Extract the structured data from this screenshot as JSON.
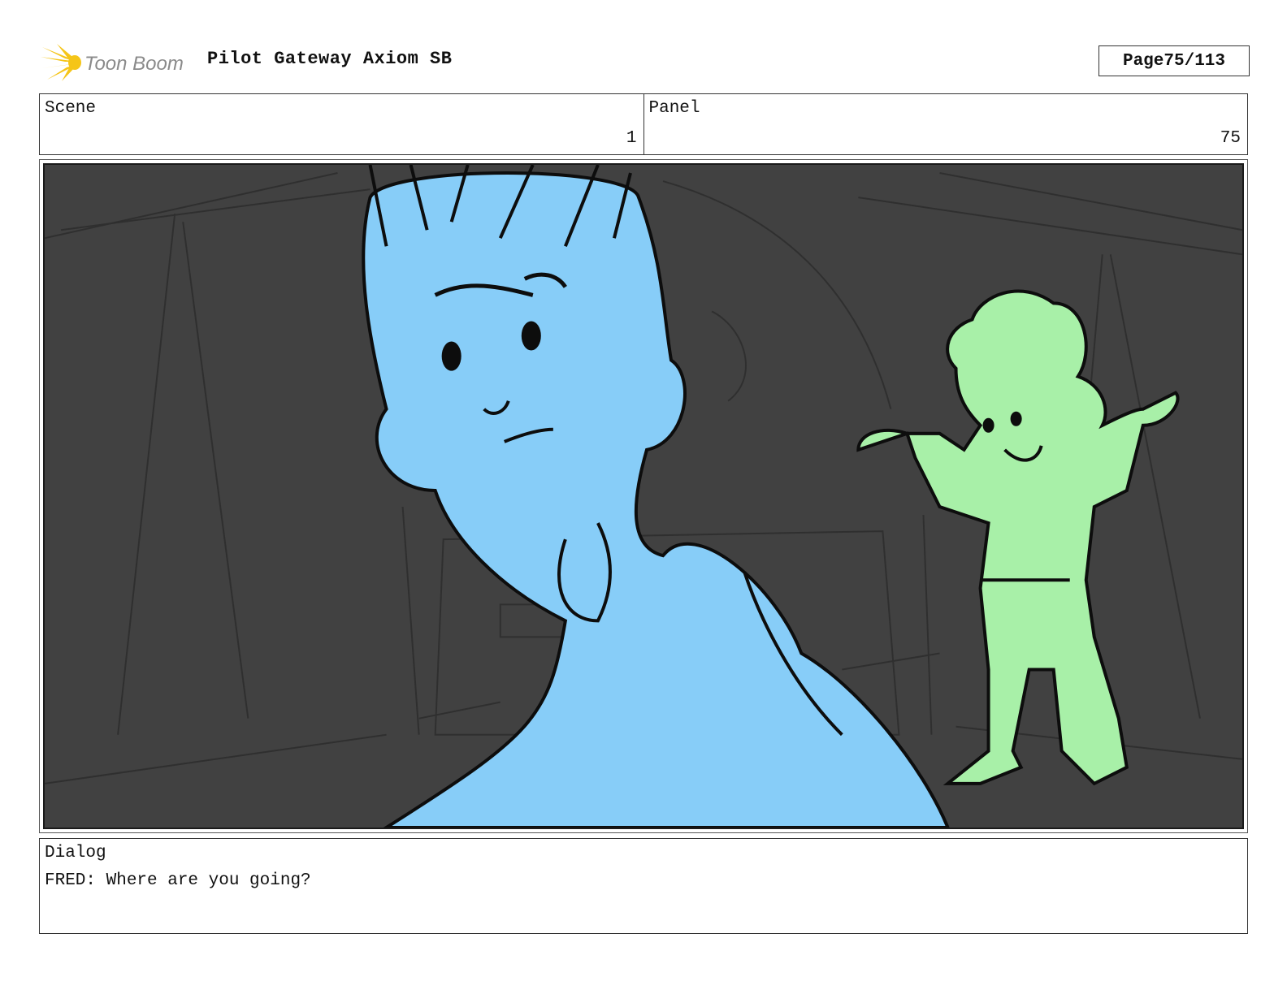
{
  "header": {
    "logo_text": "Toon Boom",
    "title": "Pilot Gateway Axiom SB",
    "page_label": "Page",
    "page_value": "75/113"
  },
  "info": {
    "scene_label": "Scene",
    "scene_value": "1",
    "panel_label": "Panel",
    "panel_value": "75"
  },
  "dialog": {
    "label": "Dialog",
    "text": "FRED: Where are you going?"
  },
  "colors": {
    "logo_accent": "#f5c518",
    "logo_text": "#8a8a8a",
    "background": "#414141",
    "character_blue": "#87cdf8",
    "character_green": "#a8f0a8",
    "ink": "#0d0d0d"
  },
  "panel": {
    "characters": [
      "blue-haired boy in foreground",
      "green character with raised arms"
    ]
  }
}
